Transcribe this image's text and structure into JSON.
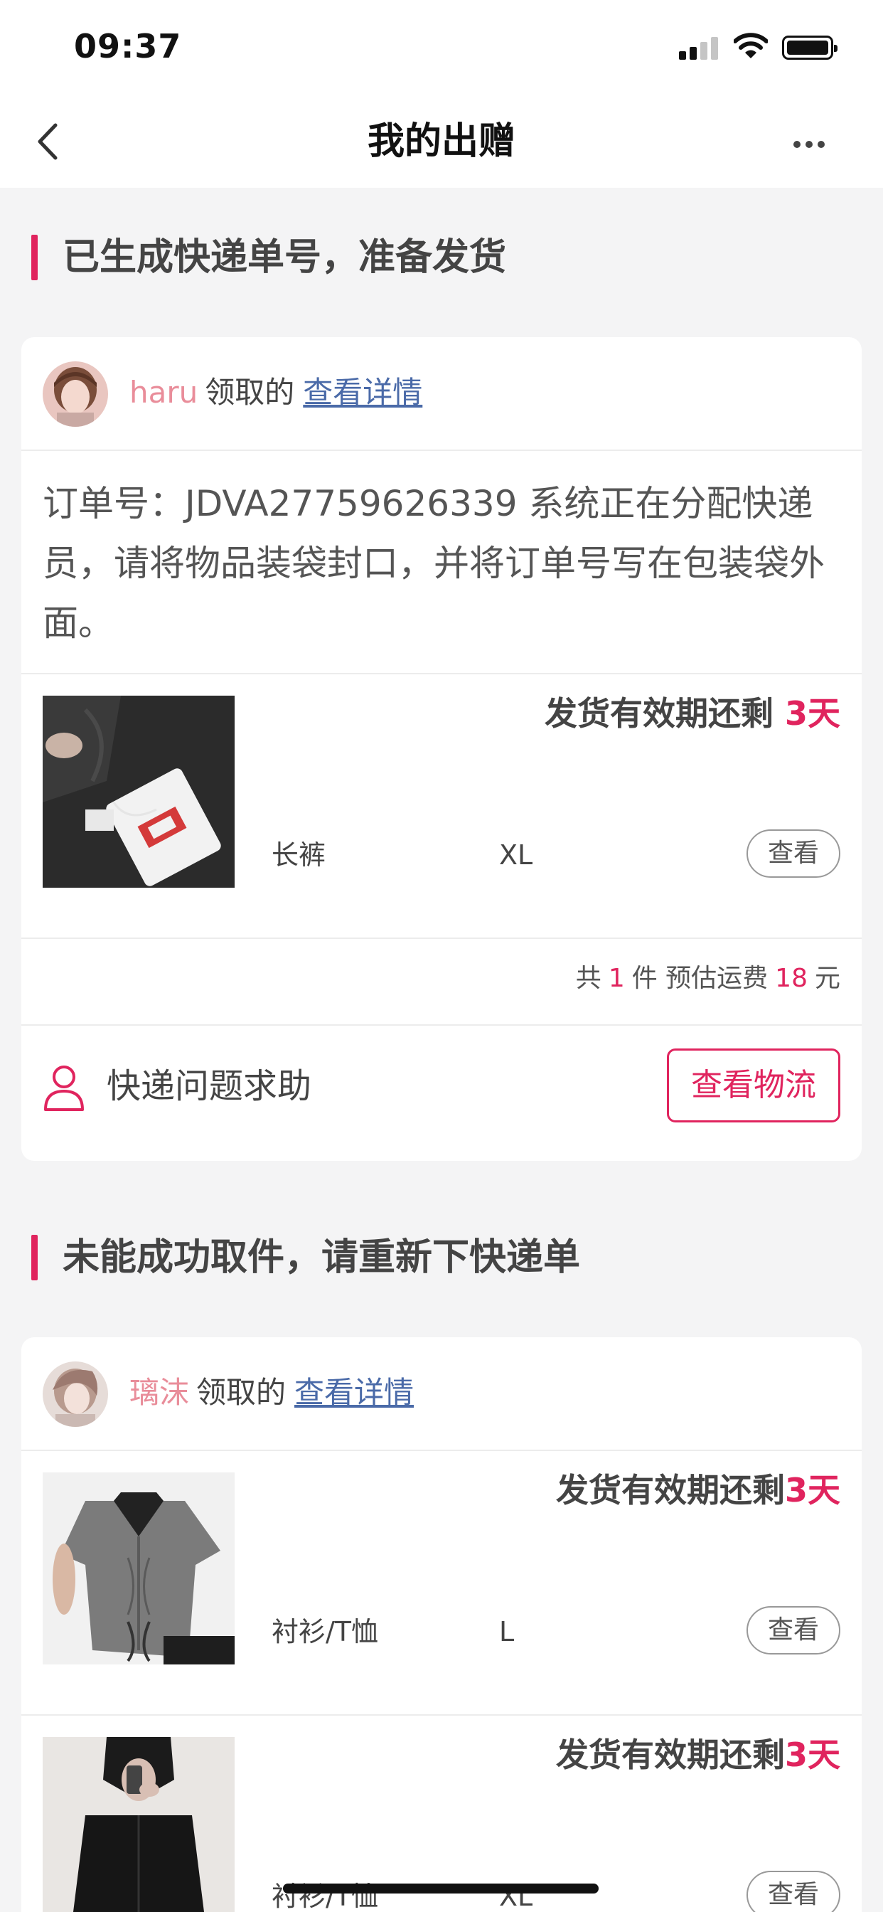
{
  "status_bar": {
    "time": "09:37"
  },
  "nav": {
    "title": "我的出赠"
  },
  "sections": [
    {
      "title": "已生成快递单号，准备发货",
      "card": {
        "user": {
          "name": "haru",
          "claimed_text": "领取的",
          "detail_link": "查看详情"
        },
        "order_note": "订单号：JDVA27759626339 系统正在分配快递员，请将物品装袋封口，并将订单号写在包装袋外面。",
        "items": [
          {
            "deadline_text": "发货有效期还剩 ",
            "deadline_days": "3天",
            "category": "长裤",
            "size": "XL",
            "view_label": "查看"
          }
        ],
        "summary": {
          "prefix": "共",
          "count": "1",
          "middle": "件 预估运费",
          "fee": "18",
          "suffix": "元"
        },
        "help_label": "快递问题求助",
        "track_label": "查看物流"
      }
    },
    {
      "title": "未能成功取件，请重新下快递单",
      "card": {
        "user": {
          "name": "璃沫",
          "claimed_text": "领取的",
          "detail_link": "查看详情"
        },
        "items": [
          {
            "deadline_text": "发货有效期还剩",
            "deadline_days": "3天",
            "category": "衬衫/T恤",
            "size": "L",
            "view_label": "查看"
          },
          {
            "deadline_text": "发货有效期还剩",
            "deadline_days": "3天",
            "category": "衬衫/T恤",
            "size": "XL",
            "view_label": "查看"
          }
        ]
      }
    }
  ],
  "icons": {
    "back": "chevron-left-icon",
    "more": "more-dots-icon",
    "help": "person-icon"
  },
  "colors": {
    "accent": "#e0245e",
    "link": "#4a6aa8",
    "username": "#e98d9a",
    "page_bg": "#f4f4f5"
  }
}
